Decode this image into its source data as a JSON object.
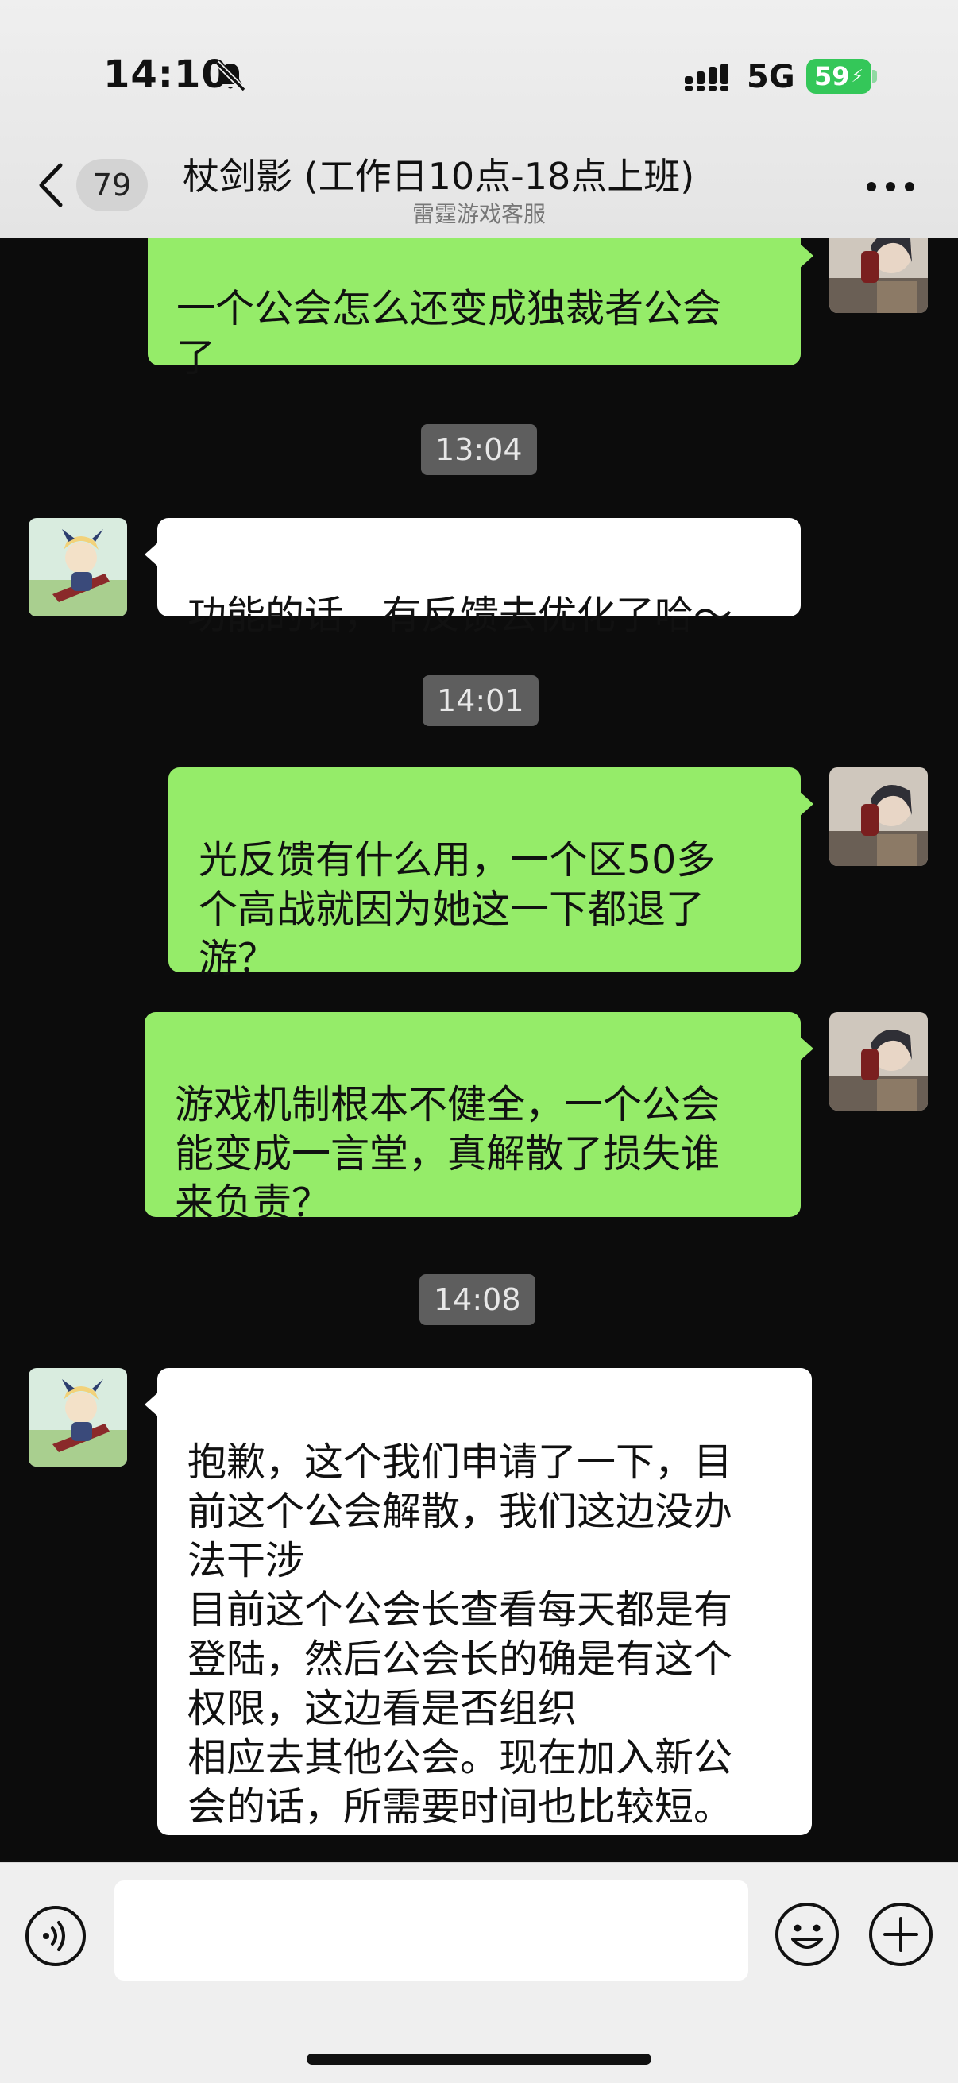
{
  "status_bar": {
    "time": "14:10",
    "network": "5G",
    "battery": "59"
  },
  "header": {
    "unread_count": "79",
    "title": "杖剑影 (工作日10点-18点上班)",
    "subtitle": "雷霆游戏客服"
  },
  "messages": {
    "m1": "一个公会怎么还变成独裁者公会\n了",
    "t1": "13:04",
    "m2": "功能的话，有反馈去优化了哈～",
    "t2": "14:01",
    "m3": "光反馈有什么用，一个区50多\n个高战就因为她这一下都退了\n游？",
    "m4": "游戏机制根本不健全，一个公会\n能变成一言堂，真解散了损失谁\n来负责？",
    "t3": "14:08",
    "m5": "抱歉，这个我们申请了一下，目\n前这个公会解散，我们这边没办\n法干涉\n目前这个公会长查看每天都是有\n登陆，然后公会长的确是有这个\n权限，这边看是否组织\n相应去其他公会。现在加入新公\n会的话，所需要时间也比较短。"
  },
  "icons": {
    "mute": "bell-slash-icon",
    "signal": "signal-bars-icon",
    "back": "chevron-left-icon",
    "more": "ellipsis-icon",
    "voice": "voice-icon",
    "emoji": "emoji-icon",
    "plus": "plus-icon"
  },
  "colors": {
    "outgoing_bubble": "#95ec69",
    "incoming_bubble": "#ffffff",
    "chat_background": "#0c0c0c",
    "battery": "#34c759"
  }
}
